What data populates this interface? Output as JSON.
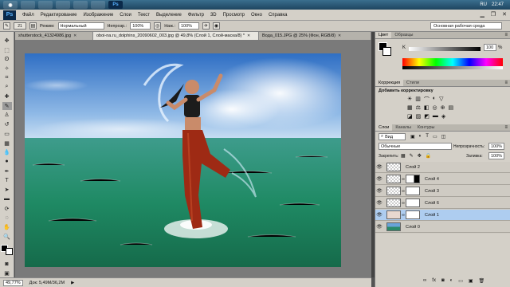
{
  "taskbar": {
    "apps": [
      "",
      "",
      "",
      "",
      "",
      "",
      "Ps"
    ],
    "tray": {
      "lang": "RU",
      "time": "22:47"
    }
  },
  "app": {
    "logo": "Ps",
    "menu": [
      "Файл",
      "Редактирование",
      "Изображение",
      "Слои",
      "Текст",
      "Выделение",
      "Фильтр",
      "3D",
      "Просмотр",
      "Окно",
      "Справка"
    ]
  },
  "options": {
    "brush_size": "21",
    "mode_label": "Режим:",
    "mode_value": "Нормальный",
    "opacity_label": "Непрозр.:",
    "opacity_value": "100%",
    "flow_label": "Наж.:",
    "flow_value": "100%",
    "workspace": "Основная рабочая среда"
  },
  "doc_tabs": [
    {
      "label": "shutterstock_41324986.jpg",
      "active": false
    },
    {
      "label": "oboi-na.ru_dolphins_20090602_003.jpg @ 49,8% (Слой 1, Слой-маска/8) *",
      "active": true
    },
    {
      "label": "Вода_015.JPG @ 25% (Фон, RGB/8)",
      "active": false
    }
  ],
  "status": {
    "zoom": "49,77%",
    "doc": "Док: 5,49M/36,2M"
  },
  "color_panel": {
    "tabs": [
      "Цвет",
      "Образцы"
    ],
    "channel": "K",
    "value": "100",
    "unit": "%"
  },
  "adjustments": {
    "tabs": [
      "Коррекция",
      "Стили"
    ],
    "title": "Добавить корректировку"
  },
  "layers": {
    "tabs": [
      "Слои",
      "Каналы",
      "Контуры"
    ],
    "kind": "Вид",
    "blend_mode": "Обычные",
    "opacity_label": "Непрозрачность:",
    "opacity_value": "100%",
    "lock_label": "Закрепить:",
    "fill_label": "Заливка:",
    "fill_value": "100%",
    "items": [
      {
        "name": "Слой 2",
        "selected": false
      },
      {
        "name": "Слой 4",
        "selected": false
      },
      {
        "name": "Слой 3",
        "selected": false
      },
      {
        "name": "Слой 6",
        "selected": false
      },
      {
        "name": "Слой 1",
        "selected": true
      },
      {
        "name": "Слой 0",
        "selected": false
      }
    ]
  }
}
